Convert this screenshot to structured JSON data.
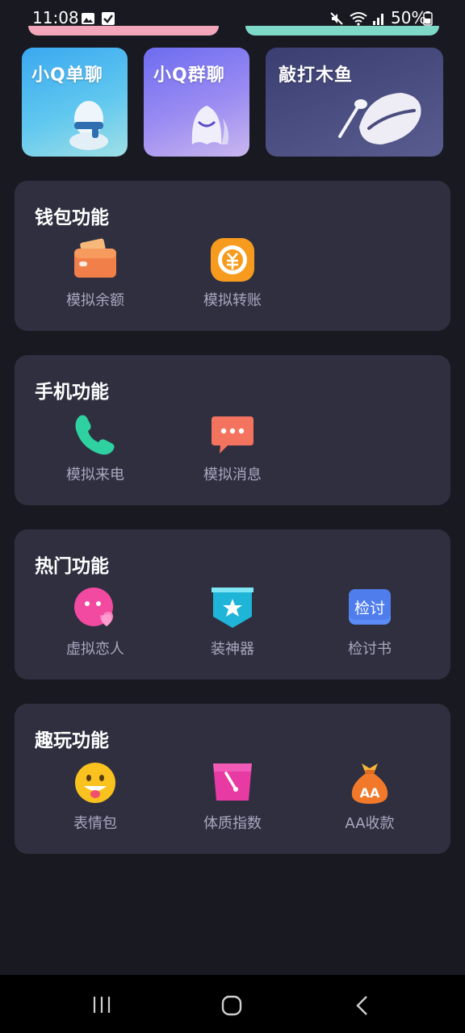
{
  "status_bar": {
    "time": "11:08",
    "battery_text": "50%",
    "icons": [
      "image-icon",
      "check-icon",
      "mute-icon",
      "wifi-icon",
      "signal-icon",
      "battery-icon"
    ]
  },
  "banners": [
    {
      "title": "小Q单聊",
      "icon": "penguin-scarf-icon"
    },
    {
      "title": "小Q群聊",
      "icon": "penguin-ghost-icon"
    },
    {
      "title": "敲打木鱼",
      "icon": "wooden-fish-icon"
    }
  ],
  "sections": [
    {
      "title": "钱包功能",
      "items": [
        {
          "label": "模拟余额",
          "icon": "wallet-icon"
        },
        {
          "label": "模拟转账",
          "icon": "transfer-icon"
        }
      ]
    },
    {
      "title": "手机功能",
      "items": [
        {
          "label": "模拟来电",
          "icon": "phone-icon"
        },
        {
          "label": "模拟消息",
          "icon": "message-icon"
        }
      ]
    },
    {
      "title": "热门功能",
      "items": [
        {
          "label": "虚拟恋人",
          "icon": "lover-face-icon"
        },
        {
          "label": "装神器",
          "icon": "badge-star-icon"
        },
        {
          "label": "检讨书",
          "icon": "book-icon",
          "icon_text": "检讨"
        }
      ]
    },
    {
      "title": "趣玩功能",
      "items": [
        {
          "label": "表情包",
          "icon": "emoji-icon"
        },
        {
          "label": "体质指数",
          "icon": "gauge-icon"
        },
        {
          "label": "AA收款",
          "icon": "money-bag-icon",
          "icon_text": "AA"
        }
      ]
    }
  ],
  "colors": {
    "background": "#191922",
    "card": "#2f2f40",
    "label": "#a8a8bf"
  },
  "nav": [
    "recents-icon",
    "home-icon",
    "back-icon"
  ]
}
